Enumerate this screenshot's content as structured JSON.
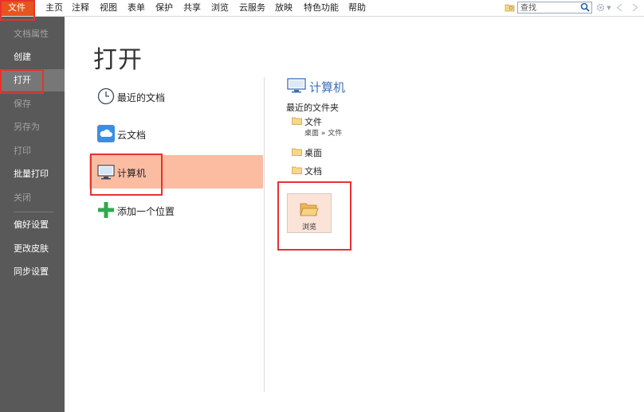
{
  "menu": {
    "items": [
      "文件",
      "主页",
      "注释",
      "视图",
      "表单",
      "保护",
      "共享",
      "浏览",
      "云服务",
      "放映",
      "特色功能",
      "帮助"
    ]
  },
  "toolbar": {
    "search_placeholder": "查找",
    "icons": [
      "folder-search-icon",
      "search-icon",
      "gear-icon",
      "dropdown-arrow-icon",
      "nav-back-icon",
      "nav-forward-icon"
    ]
  },
  "sidebar": {
    "items": [
      {
        "label": "文档属性",
        "enabled": false
      },
      {
        "label": "创建",
        "enabled": true
      },
      {
        "label": "打开",
        "enabled": true,
        "selected": true
      },
      {
        "label": "保存",
        "enabled": false
      },
      {
        "label": "另存为",
        "enabled": false
      },
      {
        "label": "打印",
        "enabled": false
      },
      {
        "label": "批量打印",
        "enabled": true
      },
      {
        "label": "关闭",
        "enabled": false
      },
      {
        "label": "偏好设置",
        "enabled": true
      },
      {
        "label": "更改皮肤",
        "enabled": true
      },
      {
        "label": "同步设置",
        "enabled": true
      }
    ]
  },
  "main": {
    "title": "打开",
    "locations": [
      {
        "label": "最近的文档",
        "icon": "clock-icon"
      },
      {
        "label": "云文档",
        "icon": "cloud-icon"
      },
      {
        "label": "计算机",
        "icon": "computer-icon",
        "selected": true
      },
      {
        "label": "添加一个位置",
        "icon": "plus-icon"
      }
    ]
  },
  "panel": {
    "title": "计算机",
    "recent_folders_label": "最近的文件夹",
    "folders": [
      {
        "name": "文件",
        "path": "桌面 » 文件"
      },
      {
        "name": "桌面"
      },
      {
        "name": "文档"
      }
    ],
    "browse_label": "浏览"
  },
  "colors": {
    "accent": "#e8541e",
    "sidebar_bg": "#595959",
    "selection": "#fbbca2",
    "highlight_box": "#e8322f",
    "panel_title": "#3b6fb5"
  }
}
